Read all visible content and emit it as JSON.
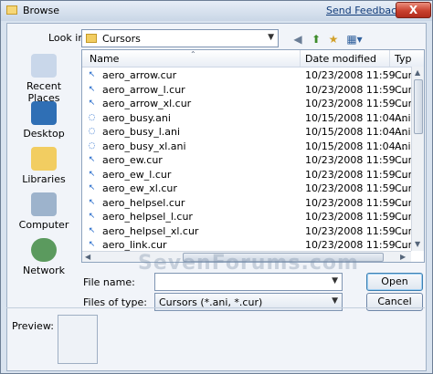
{
  "window": {
    "title": "Browse",
    "feedback_link": "Send Feedback",
    "close": "X"
  },
  "lookin": {
    "label": "Look in:",
    "value": "Cursors"
  },
  "places": [
    {
      "label": "Recent Places"
    },
    {
      "label": "Desktop"
    },
    {
      "label": "Libraries"
    },
    {
      "label": "Computer"
    },
    {
      "label": "Network"
    }
  ],
  "columns": {
    "name": "Name",
    "date": "Date modified",
    "type": "Typ"
  },
  "files": [
    {
      "name": "aero_arrow.cur",
      "date": "10/23/2008 11:59 ...",
      "type": "Cur"
    },
    {
      "name": "aero_arrow_l.cur",
      "date": "10/23/2008 11:59 ...",
      "type": "Cur"
    },
    {
      "name": "aero_arrow_xl.cur",
      "date": "10/23/2008 11:59 ...",
      "type": "Cur"
    },
    {
      "name": "aero_busy.ani",
      "date": "10/15/2008 11:04 ...",
      "type": "Ani"
    },
    {
      "name": "aero_busy_l.ani",
      "date": "10/15/2008 11:04 ...",
      "type": "Ani"
    },
    {
      "name": "aero_busy_xl.ani",
      "date": "10/15/2008 11:04 ...",
      "type": "Ani"
    },
    {
      "name": "aero_ew.cur",
      "date": "10/23/2008 11:59 ...",
      "type": "Cur"
    },
    {
      "name": "aero_ew_l.cur",
      "date": "10/23/2008 11:59 ...",
      "type": "Cur"
    },
    {
      "name": "aero_ew_xl.cur",
      "date": "10/23/2008 11:59 ...",
      "type": "Cur"
    },
    {
      "name": "aero_helpsel.cur",
      "date": "10/23/2008 11:59 ...",
      "type": "Cur"
    },
    {
      "name": "aero_helpsel_l.cur",
      "date": "10/23/2008 11:59 ...",
      "type": "Cur"
    },
    {
      "name": "aero_helpsel_xl.cur",
      "date": "10/23/2008 11:59 ...",
      "type": "Cur"
    },
    {
      "name": "aero_link.cur",
      "date": "10/23/2008 11:59 ...",
      "type": "Cur"
    }
  ],
  "filename": {
    "label": "File name:",
    "value": ""
  },
  "filetype": {
    "label": "Files of type:",
    "value": "Cursors (*.ani, *.cur)"
  },
  "buttons": {
    "open": "Open",
    "cancel": "Cancel"
  },
  "preview": {
    "label": "Preview:"
  },
  "watermark": "SevenForums.com"
}
